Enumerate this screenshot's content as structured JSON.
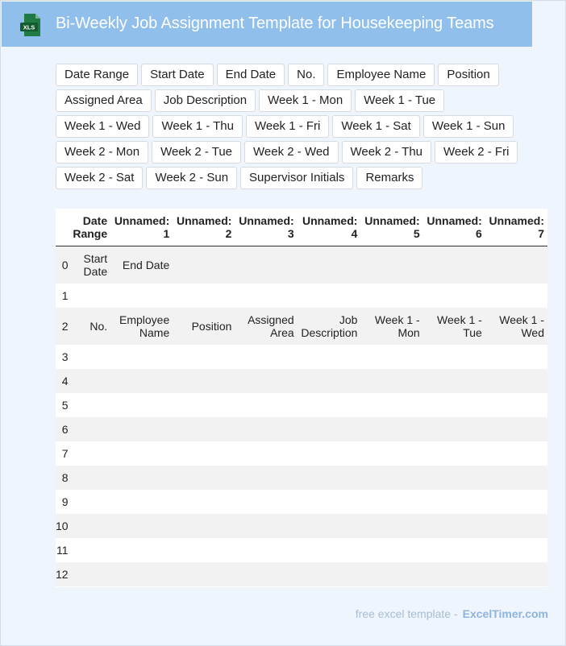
{
  "header": {
    "title": "Bi-Weekly Job Assignment Template for Housekeeping Teams",
    "icon_text": "XLS"
  },
  "chips": [
    "Date Range",
    "Start Date",
    "End Date",
    "No.",
    "Employee Name",
    "Position",
    "Assigned Area",
    "Job Description",
    "Week 1 - Mon",
    "Week 1 - Tue",
    "Week 1 - Wed",
    "Week 1 - Thu",
    "Week 1 - Fri",
    "Week 1 - Sat",
    "Week 1 - Sun",
    "Week 2 - Mon",
    "Week 2 - Tue",
    "Week 2 - Wed",
    "Week 2 - Thu",
    "Week 2 - Fri",
    "Week 2 - Sat",
    "Week 2 - Sun",
    "Supervisor Initials",
    "Remarks"
  ],
  "table": {
    "columns": [
      "",
      "Date Range",
      "Unnamed: 1",
      "Unnamed: 2",
      "Unnamed: 3",
      "Unnamed: 4",
      "Unnamed: 5",
      "Unnamed: 6",
      "Unnamed: 7"
    ],
    "rows": [
      [
        "0",
        "Start Date",
        "End Date",
        "",
        "",
        "",
        "",
        "",
        ""
      ],
      [
        "1",
        "",
        "",
        "",
        "",
        "",
        "",
        "",
        ""
      ],
      [
        "2",
        "No.",
        "Employee Name",
        "Position",
        "Assigned Area",
        "Job Description",
        "Week 1 - Mon",
        "Week 1 - Tue",
        "Week 1 - Wed"
      ],
      [
        "3",
        "",
        "",
        "",
        "",
        "",
        "",
        "",
        ""
      ],
      [
        "4",
        "",
        "",
        "",
        "",
        "",
        "",
        "",
        ""
      ],
      [
        "5",
        "",
        "",
        "",
        "",
        "",
        "",
        "",
        ""
      ],
      [
        "6",
        "",
        "",
        "",
        "",
        "",
        "",
        "",
        ""
      ],
      [
        "7",
        "",
        "",
        "",
        "",
        "",
        "",
        "",
        ""
      ],
      [
        "8",
        "",
        "",
        "",
        "",
        "",
        "",
        "",
        ""
      ],
      [
        "9",
        "",
        "",
        "",
        "",
        "",
        "",
        "",
        ""
      ],
      [
        "10",
        "",
        "",
        "",
        "",
        "",
        "",
        "",
        ""
      ],
      [
        "11",
        "",
        "",
        "",
        "",
        "",
        "",
        "",
        ""
      ],
      [
        "12",
        "",
        "",
        "",
        "",
        "",
        "",
        "",
        ""
      ]
    ]
  },
  "footer": {
    "text": "free excel template -",
    "brand": "ExcelTimer.com"
  },
  "colors": {
    "header_bg": "#8fbfea",
    "page_bg": "#eef5fc",
    "icon_green": "#1f7a44"
  }
}
